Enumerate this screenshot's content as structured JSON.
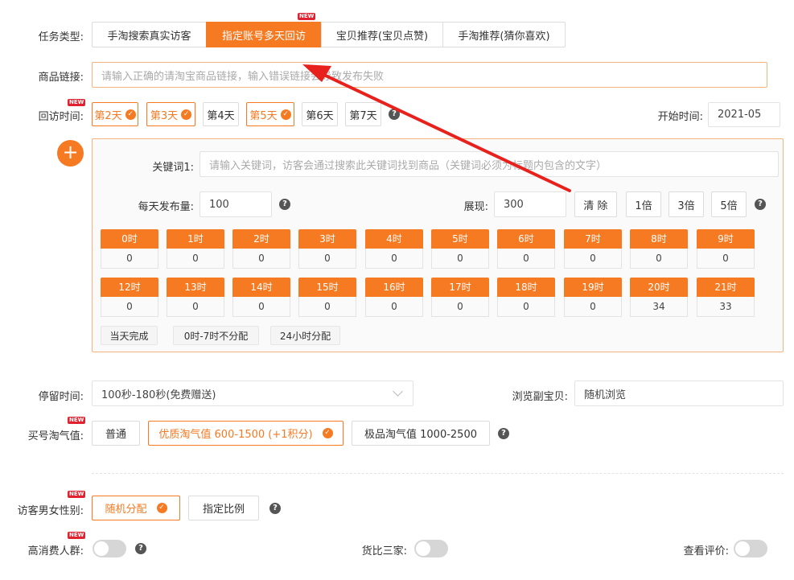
{
  "task_type": {
    "label": "任务类型:",
    "tabs": [
      "手淘搜索真实访客",
      "指定账号多天回访",
      "宝贝推荐(宝贝点赞)",
      "手淘推荐(猜你喜欢)"
    ],
    "active_index": 1,
    "new_badge": "NEW"
  },
  "product_link": {
    "label": "商品链接:",
    "placeholder": "请输入正确的请淘宝商品链接，输入错误链接会导致发布失败"
  },
  "revisit": {
    "label": "回访时间:",
    "days": [
      "第2天",
      "第3天",
      "第4天",
      "第5天",
      "第6天",
      "第7天"
    ],
    "selected": [
      true,
      true,
      false,
      true,
      false,
      false
    ],
    "start_label": "开始时间:",
    "start_value": "2021-05"
  },
  "keyword_panel": {
    "keyword_label": "关键词1:",
    "keyword_placeholder": "请输入关键词，访客会通过搜索此关键词找到商品（关键词必须为标题内包含的文字）",
    "daily_label": "每天发布量:",
    "daily_value": "100",
    "show_label": "展现:",
    "show_value": "300",
    "clear_label": "清 除",
    "multipliers": [
      "1倍",
      "3倍",
      "5倍"
    ],
    "hours_row1": [
      "0时",
      "1时",
      "2时",
      "3时",
      "4时",
      "5时",
      "6时",
      "7时",
      "8时",
      "9时"
    ],
    "values_row1": [
      "0",
      "0",
      "0",
      "0",
      "0",
      "0",
      "0",
      "0",
      "0",
      "0"
    ],
    "hours_row2": [
      "12时",
      "13时",
      "14时",
      "15时",
      "16时",
      "17时",
      "18时",
      "19时",
      "20时",
      "21时"
    ],
    "values_row2": [
      "0",
      "0",
      "0",
      "0",
      "0",
      "0",
      "0",
      "0",
      "34",
      "33"
    ],
    "dist_buttons": [
      "当天完成",
      "0时-7时不分配",
      "24小时分配"
    ]
  },
  "stay_time": {
    "label": "停留时间:",
    "value": "100秒-180秒(免费赠送)"
  },
  "browse_sub": {
    "label": "浏览副宝贝:",
    "value": "随机浏览"
  },
  "buyer_value": {
    "label": "买号淘气值:",
    "options": [
      "普通",
      "优质淘气值 600-1500 (+1积分)",
      "极品淘气值 1000-2500"
    ],
    "selected_index": 1
  },
  "gender": {
    "label": "访客男女性别:",
    "options": [
      "随机分配",
      "指定比例"
    ],
    "selected_index": 0
  },
  "high_spend": {
    "label": "高消费人群:"
  },
  "compare": {
    "label": "货比三家:"
  },
  "reviews": {
    "label": "查看评价:"
  },
  "colors": {
    "accent": "#f57a22",
    "arrow": "#e8211c",
    "badge": "#e0212f"
  },
  "icons": {
    "check": "✓",
    "help": "?",
    "plus": "+"
  }
}
